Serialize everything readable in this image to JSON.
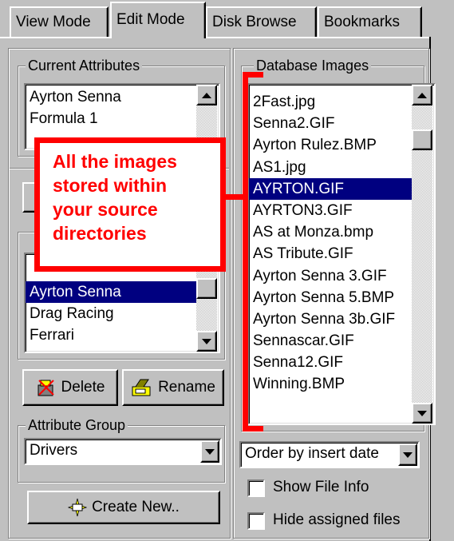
{
  "tabs": [
    {
      "label": "View Mode"
    },
    {
      "label": "Edit Mode"
    },
    {
      "label": "Disk Browse"
    },
    {
      "label": "Bookmarks"
    }
  ],
  "current_attributes": {
    "title": "Current Attributes",
    "items": [
      "Ayrton Senna",
      "Formula 1"
    ]
  },
  "attributes_list": {
    "items": [
      "Ayrton Senna",
      "Drag Racing",
      "Ferrari"
    ]
  },
  "buttons": {
    "delete": "Delete",
    "rename": "Rename",
    "create_new": "Create New.."
  },
  "attribute_group": {
    "title": "Attribute Group",
    "value": "Drivers"
  },
  "database_images": {
    "title": "Database Images",
    "items": [
      "2Fast.jpg",
      "Senna2.GIF",
      "Ayrton Rulez.BMP",
      "AS1.jpg",
      "AYRTON.GIF",
      "AYRTON3.GIF",
      "AS at Monza.bmp",
      "AS Tribute.GIF",
      "Ayrton Senna 3.GIF",
      "Ayrton Senna 5.BMP",
      "Ayrton Senna 3b.GIF",
      "Sennascar.GIF",
      "Senna12.GIF",
      "Winning.BMP"
    ]
  },
  "order_by": {
    "value": "Order by insert date"
  },
  "checkboxes": {
    "show_file_info": "Show File Info",
    "hide_assigned": "Hide assigned files"
  },
  "annotation": {
    "lines": [
      "All the images",
      "stored within",
      "your source",
      "directories"
    ],
    "color": "#ff0000"
  },
  "colors": {
    "selection": "#000080",
    "face": "#c0c0c0"
  }
}
